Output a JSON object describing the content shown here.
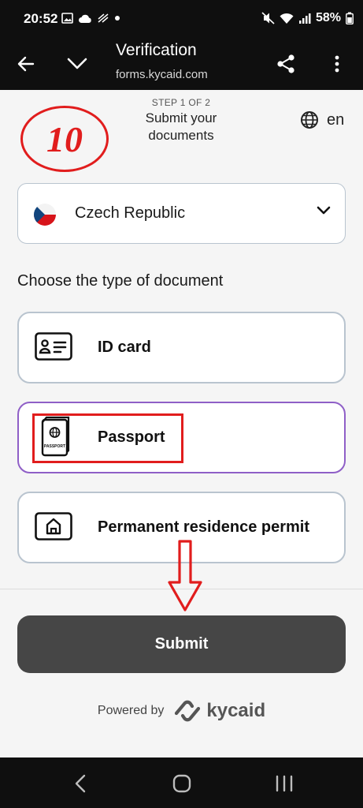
{
  "status_bar": {
    "time": "20:52",
    "battery": "58%",
    "icons_left": [
      "gallery-icon",
      "cloud-icon",
      "sync-icon",
      "dot-icon"
    ],
    "icons_right": [
      "mute-icon",
      "wifi-icon",
      "signal-icon",
      "battery-icon"
    ]
  },
  "app_bar": {
    "title": "Verification",
    "url": "forms.kycaid.com"
  },
  "annotation": {
    "number": "10",
    "color": "#e11d1d"
  },
  "step": {
    "label": "STEP 1 OF 2",
    "title_line1": "Submit your",
    "title_line2": "documents"
  },
  "language": {
    "code": "en"
  },
  "country": {
    "selected": "Czech Republic"
  },
  "documents": {
    "heading": "Choose the type of document",
    "options": [
      {
        "label": "ID card",
        "icon": "id-card-icon",
        "selected": false
      },
      {
        "label": "Passport",
        "icon": "passport-icon",
        "selected": true,
        "icon_text": "PASSPORT"
      },
      {
        "label": "Permanent residence permit",
        "icon": "residence-permit-icon",
        "selected": false
      }
    ]
  },
  "submit": {
    "label": "Submit"
  },
  "footer": {
    "powered_by": "Powered by",
    "brand": "kycaid"
  },
  "colors": {
    "accent_selected": "#8f5fc7",
    "button_bg": "#464646",
    "border": "#b9c4cf"
  }
}
